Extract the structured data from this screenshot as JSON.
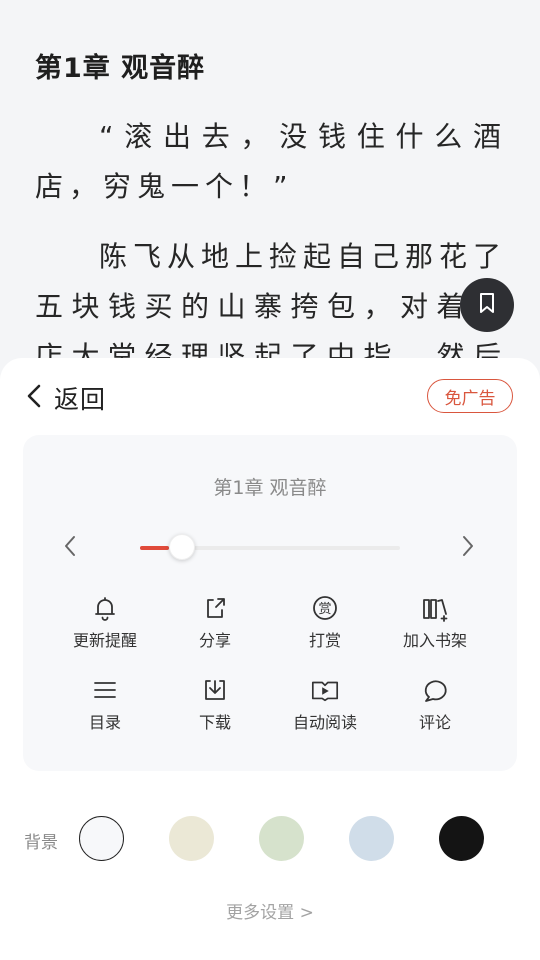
{
  "reader": {
    "chapter_title": "第1章 观音醉",
    "paragraphs": [
      "“滚出去，没钱住什么酒店，穷鬼一个！”",
      "陈飞从地上捡起自己那花了五块钱买的山寨挎包，对着酒店大堂经理竖起了中指，然后在这"
    ]
  },
  "icons": {
    "bookmark": "bookmark-icon",
    "back": "chevron-left-icon"
  },
  "panel": {
    "back_label": "返回",
    "adfree_label": "免广告",
    "current_chapter": "第1章 观音醉",
    "progress": 0.07,
    "tools": [
      {
        "label": "更新提醒",
        "icon": "bell-icon"
      },
      {
        "label": "分享",
        "icon": "share-icon"
      },
      {
        "label": "打赏",
        "icon": "reward-icon"
      },
      {
        "label": "加入书架",
        "icon": "bookshelf-add-icon"
      },
      {
        "label": "目录",
        "icon": "menu-list-icon"
      },
      {
        "label": "下载",
        "icon": "download-icon"
      },
      {
        "label": "自动阅读",
        "icon": "auto-read-icon"
      },
      {
        "label": "评论",
        "icon": "comment-icon"
      }
    ],
    "background_label": "背景",
    "backgrounds": [
      "#f7f8fa",
      "#ebe8d6",
      "#d6e2cc",
      "#d0dde9",
      "#141414"
    ],
    "selected_background": 0,
    "more_settings_label": "更多设置 >"
  },
  "colors": {
    "accent": "#e04a3a",
    "adfree": "#d9563e"
  }
}
